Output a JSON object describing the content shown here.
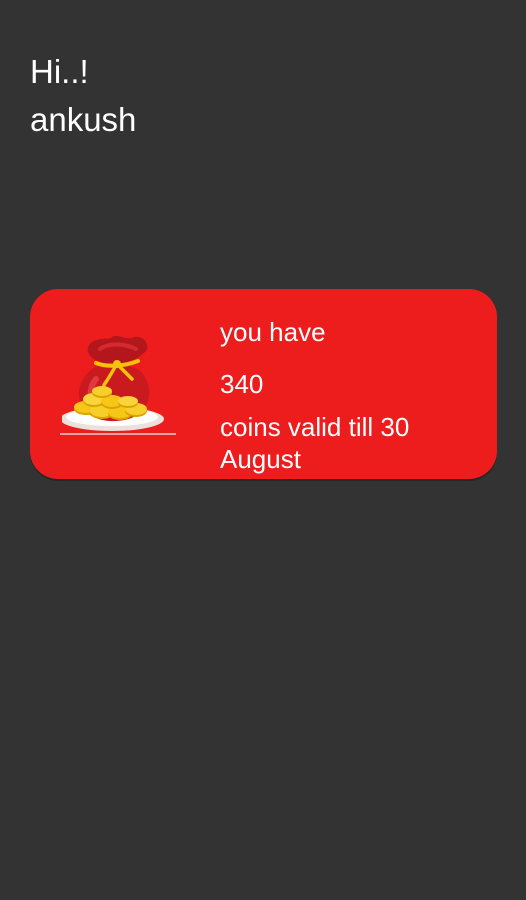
{
  "greeting": {
    "salutation": "Hi..!",
    "username": "ankush"
  },
  "coins": {
    "label": "you have",
    "amount": "340",
    "validity": "coins valid till 30 August",
    "icon": "coin-bag-icon",
    "card_color": "#ee1d1d"
  }
}
